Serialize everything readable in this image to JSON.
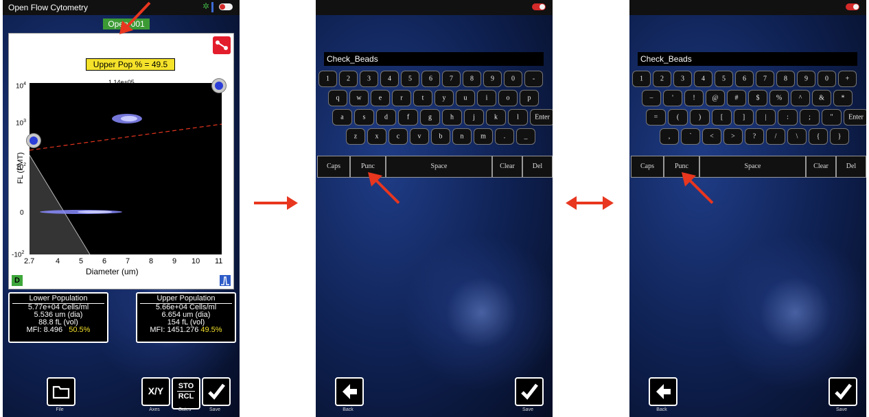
{
  "panel1": {
    "app_title": "Open Flow Cytometry",
    "title_badge": "Open-001",
    "gate_label": "Upper Pop % = 49.5",
    "top_count": "1.14e+05",
    "y_axis_label": "FL (PMT)",
    "x_axis_label": "Diameter (um)",
    "y_ticks": [
      "10",
      "10",
      "10",
      "0",
      "-10"
    ],
    "y_tick_exponents": [
      "4",
      "3",
      "2",
      "",
      "2"
    ],
    "x_ticks": [
      "2.7",
      "4",
      "5",
      "6",
      "7",
      "8",
      "9",
      "10",
      "11"
    ],
    "corner_left": "D",
    "lower": {
      "header": "Lower Population",
      "cells": "5.77e+04 Cells/ml",
      "dia": "5.536 um (dia)",
      "vol": "88.8 fL (vol)",
      "mfi_label": "MFI: 8.496",
      "pct": "50.5%"
    },
    "upper": {
      "header": "Upper Population",
      "cells": "5.66e+04 Cells/ml",
      "dia": "6.654 um (dia)",
      "vol": "154 fL (vol)",
      "mfi_label": "MFI: 1451.276",
      "pct": "49.5%"
    },
    "toolbar": {
      "file_label": "File",
      "axes_btn": "X/Y",
      "axes_label": "Axes",
      "gates_btn_top": "STO",
      "gates_btn_bottom": "RCL",
      "gates_label": "Gates",
      "save_label": "Save"
    }
  },
  "panel2": {
    "text_value": "Check_Beads",
    "row1": [
      "1",
      "2",
      "3",
      "4",
      "5",
      "6",
      "7",
      "8",
      "9",
      "0",
      "-"
    ],
    "row2": [
      "q",
      "w",
      "e",
      "r",
      "t",
      "y",
      "u",
      "i",
      "o",
      "p"
    ],
    "row3": [
      "a",
      "s",
      "d",
      "f",
      "g",
      "h",
      "j",
      "k",
      "l",
      "Enter"
    ],
    "row4": [
      "z",
      "x",
      "c",
      "v",
      "b",
      "n",
      "m",
      ".",
      "_"
    ],
    "func": [
      "Caps",
      "Punc",
      "Space",
      "Clear",
      "Del"
    ],
    "back_label": "Back",
    "save_label": "Save"
  },
  "panel3": {
    "text_value": "Check_Beads",
    "row1": [
      "1",
      "2",
      "3",
      "4",
      "5",
      "6",
      "7",
      "8",
      "9",
      "0",
      "+"
    ],
    "row2": [
      "–",
      "'",
      "!",
      "@",
      "#",
      "$",
      "%",
      "^",
      "&",
      "*"
    ],
    "row3": [
      "=",
      "(",
      ")",
      "[",
      "]",
      "|",
      ":",
      ";",
      "\"",
      "Enter"
    ],
    "row4": [
      ",",
      "`",
      "<",
      ">",
      "?",
      "/",
      "\\",
      "{",
      "}"
    ],
    "func": [
      "Caps",
      "Punc",
      "Space",
      "Clear",
      "Del"
    ],
    "back_label": "Back",
    "save_label": "Save"
  },
  "colors": {
    "accent_red": "#e8361f",
    "title_green": "#3c9a35",
    "gate_yellow": "#f5e22a"
  }
}
